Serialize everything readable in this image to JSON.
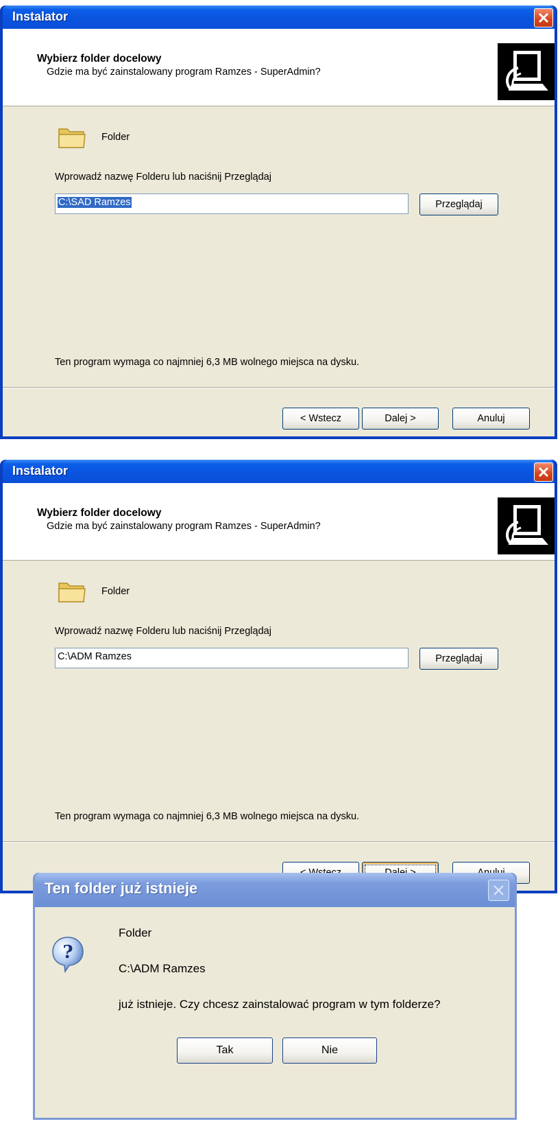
{
  "installer_windows": [
    {
      "title": "Instalator",
      "header_title": "Wybierz folder docelowy",
      "header_subtitle": "Gdzie ma być zainstalowany program Ramzes - SuperAdmin?",
      "folder_label": "Folder",
      "prompt": "Wprowadź nazwę Folderu lub naciśnij Przeglądaj",
      "path_value": "C:\\SAD Ramzes",
      "path_selected": true,
      "browse_label": "Przeglądaj",
      "space_note": "Ten program wymaga co najmniej 6,3 MB wolnego miejsca na dysku.",
      "back_label": "< Wstecz",
      "next_label": "Dalej >",
      "cancel_label": "Anuluj"
    },
    {
      "title": "Instalator",
      "header_title": "Wybierz folder docelowy",
      "header_subtitle": "Gdzie ma być zainstalowany program Ramzes - SuperAdmin?",
      "folder_label": "Folder",
      "prompt": "Wprowadź nazwę Folderu lub naciśnij Przeglądaj",
      "path_value": "C:\\ADM Ramzes",
      "path_selected": false,
      "browse_label": "Przeglądaj",
      "space_note": "Ten program wymaga co najmniej 6,3 MB wolnego miejsca na dysku.",
      "back_label": "< Wstecz",
      "next_label": "Dalej >",
      "cancel_label": "Anuluj"
    }
  ],
  "message_box": {
    "title": "Ten folder już istnieje",
    "line1": "Folder",
    "line2": "C:\\ADM Ramzes",
    "line3": "już istnieje. Czy chcesz zainstalować program w tym folderze?",
    "yes_label": "Tak",
    "no_label": "Nie",
    "icon": "question-icon"
  },
  "colors": {
    "titlebar_blue": "#0a53de",
    "dialog_face": "#ece9d8",
    "close_red": "#d8431d",
    "selection_blue": "#316ac5"
  }
}
